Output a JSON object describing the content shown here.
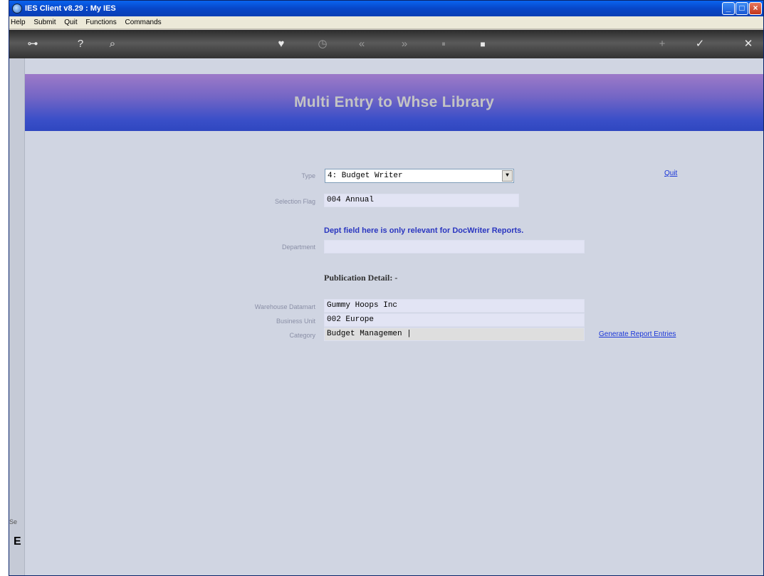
{
  "window": {
    "title": "IES Client v8.29 : My IES"
  },
  "menu": [
    "Help",
    "Submit",
    "Quit",
    "Functions",
    "Commands"
  ],
  "toolbar": {
    "icons": [
      "key-icon",
      "help-icon",
      "search-icon",
      "heart-icon",
      "clock-icon",
      "rewind-icon",
      "forward-icon",
      "pause-icon",
      "stop-icon",
      "plus-icon",
      "check-icon",
      "close-icon"
    ],
    "glyphs": {
      "key": "⊶",
      "help": "?",
      "search": "⌕",
      "heart": "♥",
      "clock": "◷",
      "rewind": "«",
      "forward": "»",
      "pause": "⏸",
      "stop": "■",
      "plus": "+",
      "check": "✓",
      "close": "✕"
    }
  },
  "page": {
    "title": "Multi Entry to Whse Library"
  },
  "form": {
    "type_label": "Type",
    "type_value": "4: Budget Writer",
    "selection_flag_label": "Selection Flag",
    "selection_flag_value": "004 Annual",
    "dept_note": "Dept field here is only relevant for  DocWriter Reports.",
    "department_label": "Department",
    "department_value": "",
    "publication_heading": "Publication Detail: -",
    "warehouse_label": "Warehouse Datamart",
    "warehouse_value": "Gummy Hoops Inc",
    "business_unit_label": "Business Unit",
    "business_unit_value": "002 Europe",
    "category_label": "Category",
    "category_value": "Budget Managemen |"
  },
  "links": {
    "quit": "Quit",
    "generate": "Generate Report Entries"
  },
  "sidebar": {
    "sel_text": "Se",
    "sel_char": "E"
  }
}
